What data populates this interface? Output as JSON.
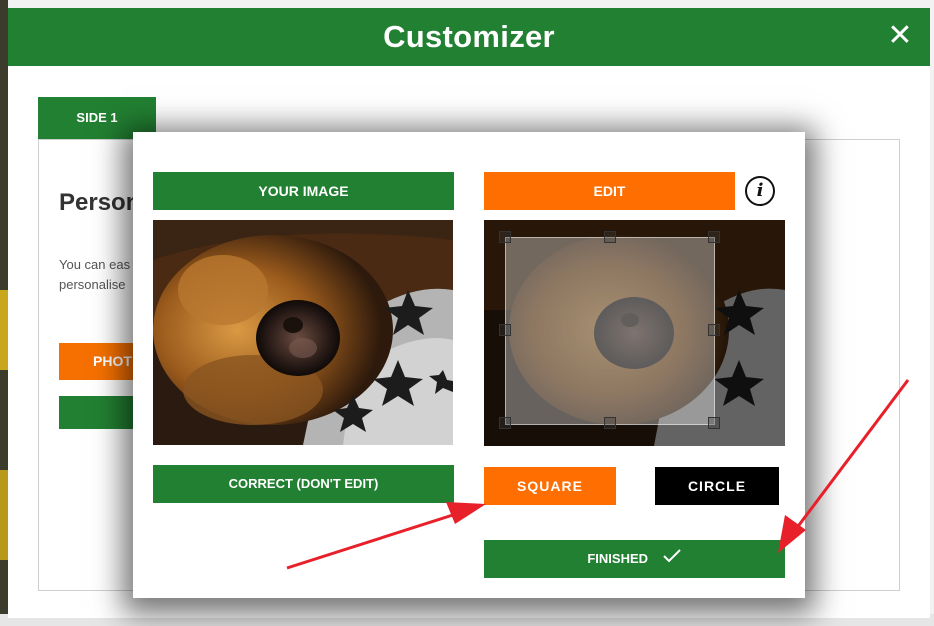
{
  "window": {
    "title": "Customizer",
    "close_label": "✕"
  },
  "side_tab": {
    "label": "SIDE 1"
  },
  "panel": {
    "heading": "Person balls h",
    "description": "You can eas golf balls be personalise",
    "photo_button_label": "PHOT"
  },
  "modal": {
    "your_image_label": "YOUR IMAGE",
    "edit_label": "EDIT",
    "info_icon": "i",
    "correct_label": "CORRECT (DON'T EDIT)",
    "square_label": "SQUARE",
    "circle_label": "CIRCLE",
    "finished_label": "FINISHED"
  },
  "icons": {
    "close": "close-icon",
    "info": "info-icon",
    "check": "checkmark-icon"
  },
  "colors": {
    "green": "#228032",
    "orange": "#ff6e00",
    "black": "#000000",
    "arrow": "#e8202a"
  }
}
